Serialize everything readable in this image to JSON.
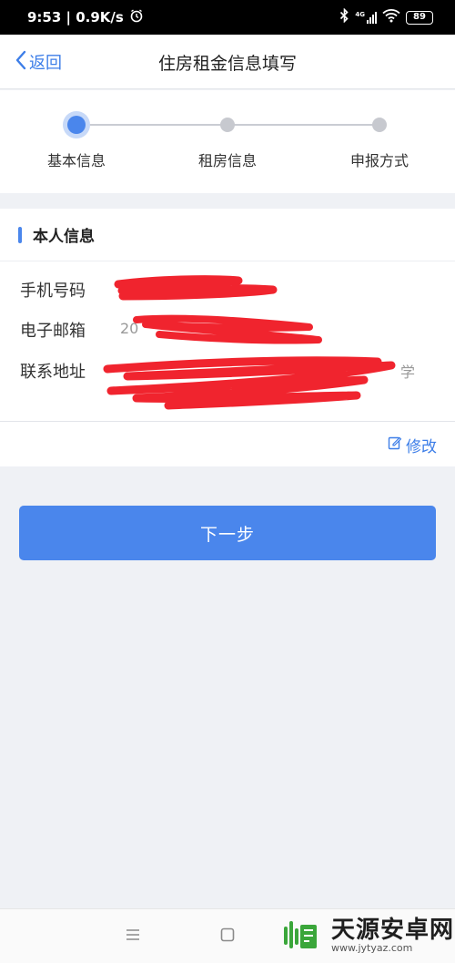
{
  "status_bar": {
    "time_speed": "9:53 | 0.9K/s",
    "battery": "89",
    "network": "4G"
  },
  "nav": {
    "back_label": "返回",
    "title": "住房租金信息填写"
  },
  "steps": [
    {
      "label": "基本信息",
      "active": true
    },
    {
      "label": "租房信息",
      "active": false
    },
    {
      "label": "申报方式",
      "active": false
    }
  ],
  "personal_info": {
    "title": "本人信息",
    "phone_label": "手机号码",
    "email_label": "电子邮箱",
    "email_value_visible": "20",
    "address_label": "联系地址",
    "address_value_visible": "学",
    "edit_label": "修改"
  },
  "next_button": "下一步",
  "watermark": {
    "text": "天源安卓网",
    "url": "www.jytyaz.com"
  },
  "colors": {
    "accent": "#4a86ec",
    "link": "#3d7ee8",
    "redaction": "#f0242e"
  }
}
